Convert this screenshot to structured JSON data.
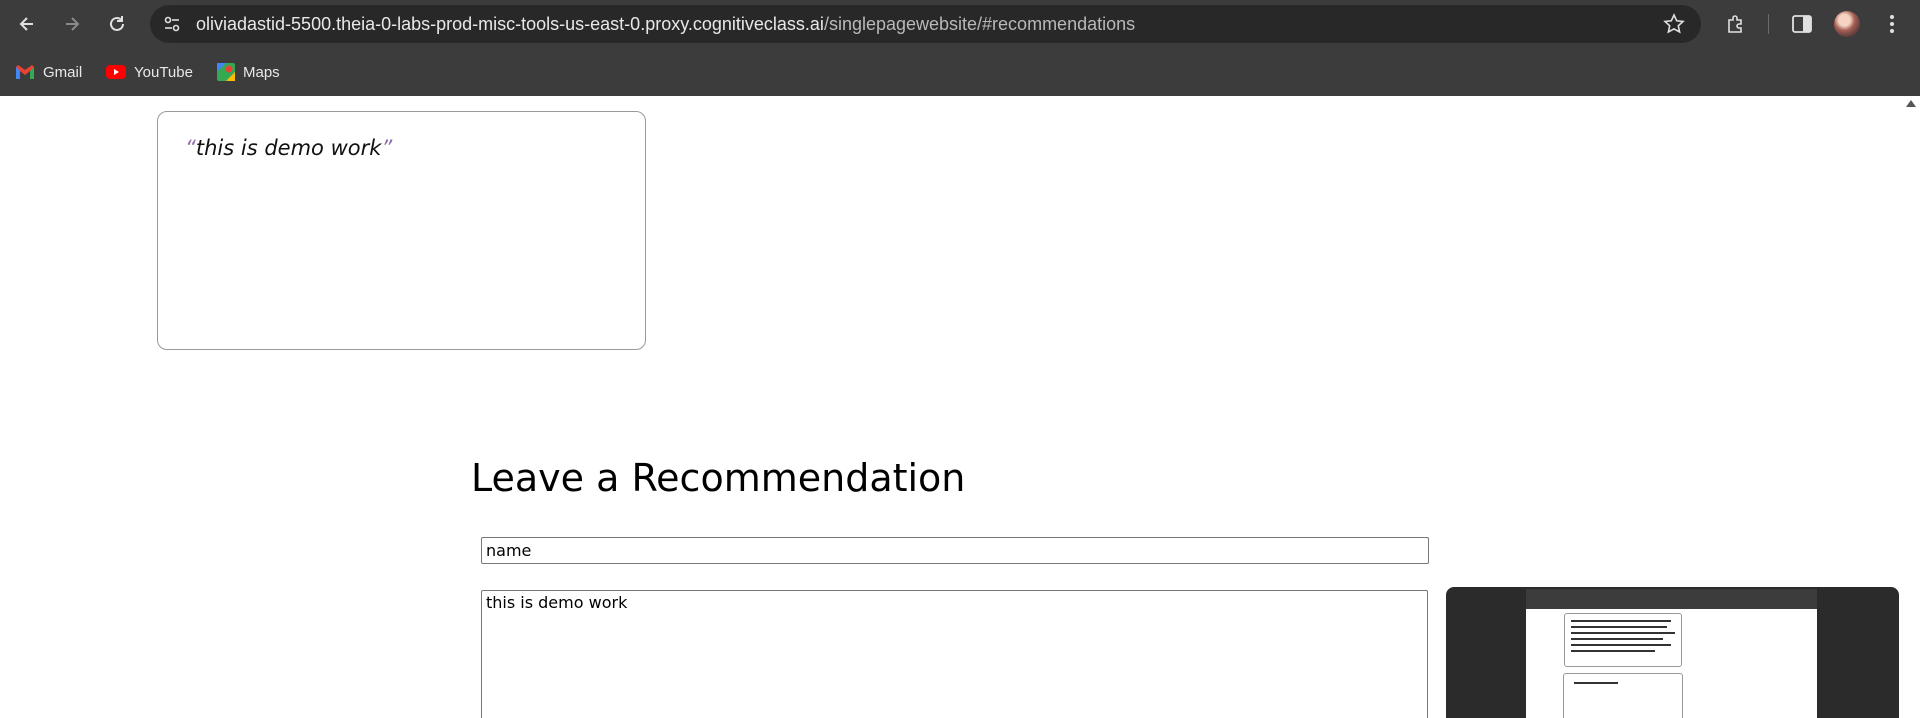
{
  "browser": {
    "url_host": "oliviadastid-5500.theia-0-labs-prod-misc-tools-us-east-0.proxy.cognitiveclass.ai",
    "url_path": "/singlepagewebsite/#recommendations",
    "icons": [
      "back-icon",
      "forward-icon",
      "reload-icon",
      "site-info-icon",
      "star-icon",
      "extensions-icon",
      "side-panel-icon",
      "avatar",
      "menu-icon"
    ]
  },
  "bookmarks": [
    {
      "label": "Gmail",
      "icon": "gmail-icon"
    },
    {
      "label": "YouTube",
      "icon": "youtube-icon"
    },
    {
      "label": "Maps",
      "icon": "maps-icon"
    }
  ],
  "recommendation": {
    "open_quote": "“",
    "text": "this is demo work",
    "close_quote": "”"
  },
  "form": {
    "heading": "Leave a Recommendation",
    "name_value": "name",
    "message_value": "this is demo work"
  },
  "colors": {
    "chrome": "#3c3c3c",
    "omnibox": "#282828",
    "quote_accent": "#8f6fb0"
  }
}
